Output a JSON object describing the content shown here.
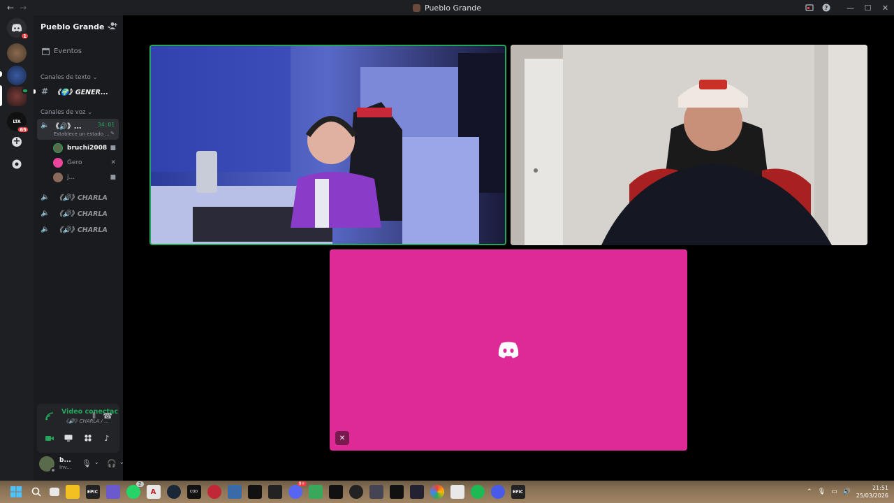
{
  "window": {
    "title": "Pueblo Grande",
    "back_glyph": "←",
    "forward_glyph": "→",
    "inbox_icon": "inbox-icon",
    "help_icon": "help-icon",
    "minimize_glyph": "—",
    "maximize_glyph": "☐",
    "close_glyph": "✕"
  },
  "rail": {
    "home_badge": "1",
    "servers": [
      {
        "name": "server-1"
      },
      {
        "name": "server-2"
      },
      {
        "name": "server-3-active"
      },
      {
        "name": "server-lta",
        "badge": "65",
        "label": "LTA"
      }
    ],
    "add_glyph": "+",
    "discover_glyph": "⊘"
  },
  "sidebar": {
    "server_name": "Pueblo Grande",
    "events_label": "Eventos",
    "text_category": "Canales de texto",
    "text_channel": "《🌍》GENER...",
    "voice_category": "Canales de voz",
    "active_voice": {
      "name": "《🔊》...",
      "timer": "34:01",
      "status": "Establece un estado ..."
    },
    "users": [
      {
        "name": "bruchi2008",
        "icon": "video-icon",
        "avatar_color": "#5a6b4a"
      },
      {
        "name": "Gero",
        "icon": "deafened-icon",
        "avatar_color": "#eb459e"
      },
      {
        "name": "j...",
        "icon": "video-icon",
        "avatar_color": "#8a6a5a"
      }
    ],
    "voice_channels": [
      "《🔊》CHARLA",
      "《🔊》CHARLA",
      "《🔊》CHARLA"
    ]
  },
  "voice_panel": {
    "status": "Video conectac",
    "channel": "《🔊》CHARLA / ...",
    "status_color": "#23a55a"
  },
  "user_panel": {
    "name": "b...",
    "sub": "Inv..."
  },
  "stage": {
    "tile3_color": "#dd2a97"
  },
  "taskbar": {
    "time": "21:51",
    "date": "25/03/2026",
    "whatsapp_badge": "2",
    "discord_badge": "9+"
  }
}
